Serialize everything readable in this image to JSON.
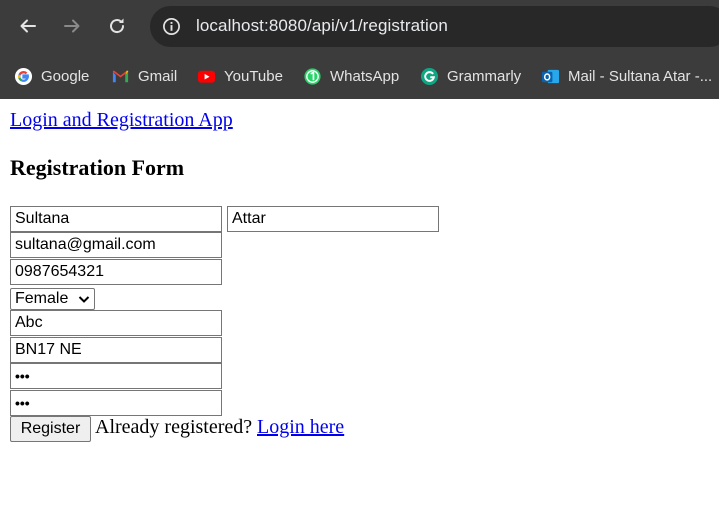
{
  "browser": {
    "url": "localhost:8080/api/v1/registration",
    "bookmarks": [
      {
        "label": "Google",
        "icon": "google-icon"
      },
      {
        "label": "Gmail",
        "icon": "gmail-icon"
      },
      {
        "label": "YouTube",
        "icon": "youtube-icon"
      },
      {
        "label": "WhatsApp",
        "icon": "whatsapp-icon"
      },
      {
        "label": "Grammarly",
        "icon": "grammarly-icon"
      },
      {
        "label": "Mail - Sultana Atar -...",
        "icon": "outlook-icon"
      }
    ],
    "colors": {
      "chrome": "#3c3c3c",
      "omnibox": "#282828",
      "text": "#e3e3e3"
    }
  },
  "page": {
    "app_link": "Login and Registration App",
    "form_title": "Registration Form",
    "fields": {
      "first_name": "Sultana",
      "last_name": "Attar",
      "email": "sultana@gmail.com",
      "phone": "0987654321",
      "gender": "Female",
      "address1": "Abc",
      "address2": "BN17 NE",
      "password": "•••",
      "confirm_password": "•••"
    },
    "register_button": "Register",
    "already_text": "Already registered?",
    "login_link": "Login here",
    "colors": {
      "link": "#0000ee"
    }
  }
}
